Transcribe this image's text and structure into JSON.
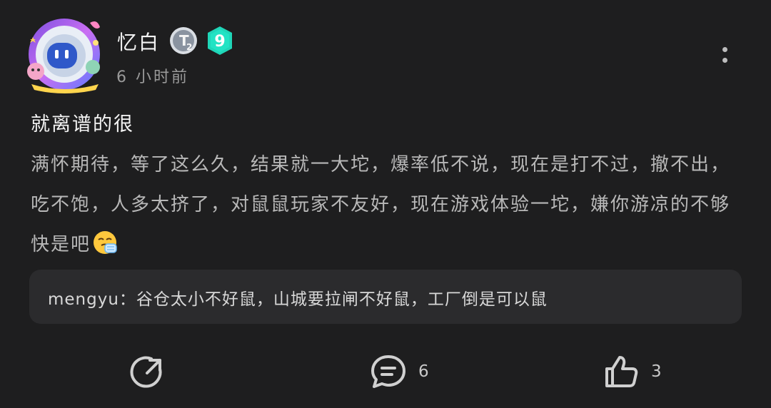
{
  "post": {
    "author": "忆白",
    "level": "9",
    "badge_text": "2",
    "time": "6 小时前",
    "title": "就离谱的很",
    "body": "满怀期待，等了这么久，结果就一大坨，爆率低不说，现在是打不过，撤不出，吃不饱，人多太挤了，对鼠鼠玩家不友好，现在游戏体验一坨，嫌你游凉的不够快是吧"
  },
  "comment_preview": {
    "text": "mengyu：谷仓太小不好鼠，山城要拉闸不好鼠，工厂倒是可以鼠"
  },
  "actions": {
    "share_icon": "share-icon",
    "comment_icon": "comment-icon",
    "comment_count": "6",
    "like_icon": "thumbs-up-icon",
    "like_count": "3"
  },
  "colors": {
    "background": "#1e1e1f",
    "comment_box": "#2b2b2d",
    "level_badge": "#1fd6b8"
  }
}
